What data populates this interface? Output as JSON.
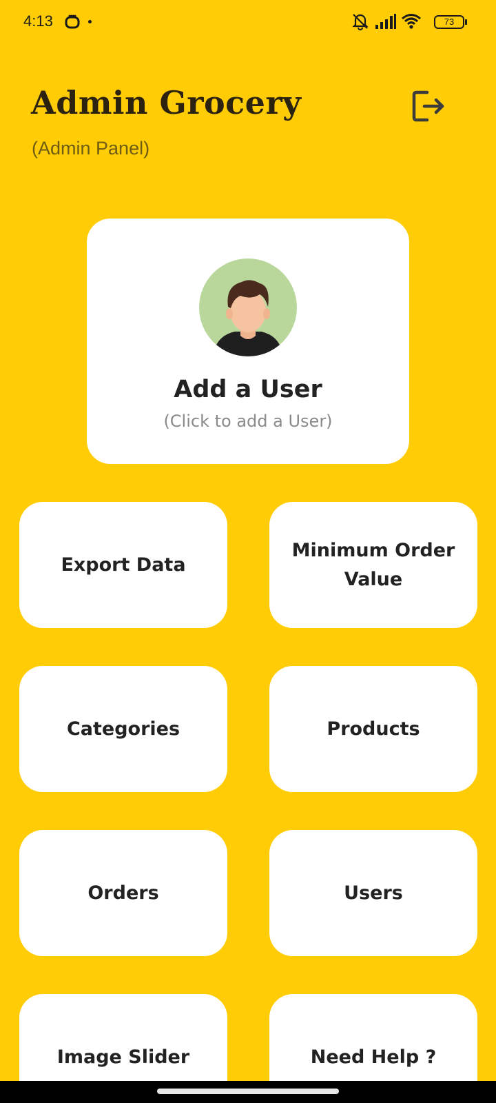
{
  "status_bar": {
    "time": "4:13",
    "battery": "73",
    "icons": [
      "app-notification-icon",
      "dot-icon",
      "bell-muted-icon",
      "signal-icon",
      "wifi-icon",
      "battery-icon"
    ]
  },
  "header": {
    "title": "Admin Grocery",
    "subtitle": "(Admin Panel)",
    "logout_icon": "logout-icon"
  },
  "add_user": {
    "title": "Add a User",
    "subtitle": "(Click to add a User)",
    "avatar_icon": "user-avatar"
  },
  "tiles": [
    {
      "label": "Export Data"
    },
    {
      "label": "Minimum Order Value"
    },
    {
      "label": "Categories"
    },
    {
      "label": "Products"
    },
    {
      "label": "Orders"
    },
    {
      "label": "Users"
    },
    {
      "label": "Image Slider"
    },
    {
      "label": "Need Help ?"
    }
  ],
  "colors": {
    "background": "#FFCC05",
    "card": "#FFFFFF",
    "title": "#2B2310",
    "subtitle": "#6E5C12",
    "avatar_bg": "#B9D79A"
  }
}
